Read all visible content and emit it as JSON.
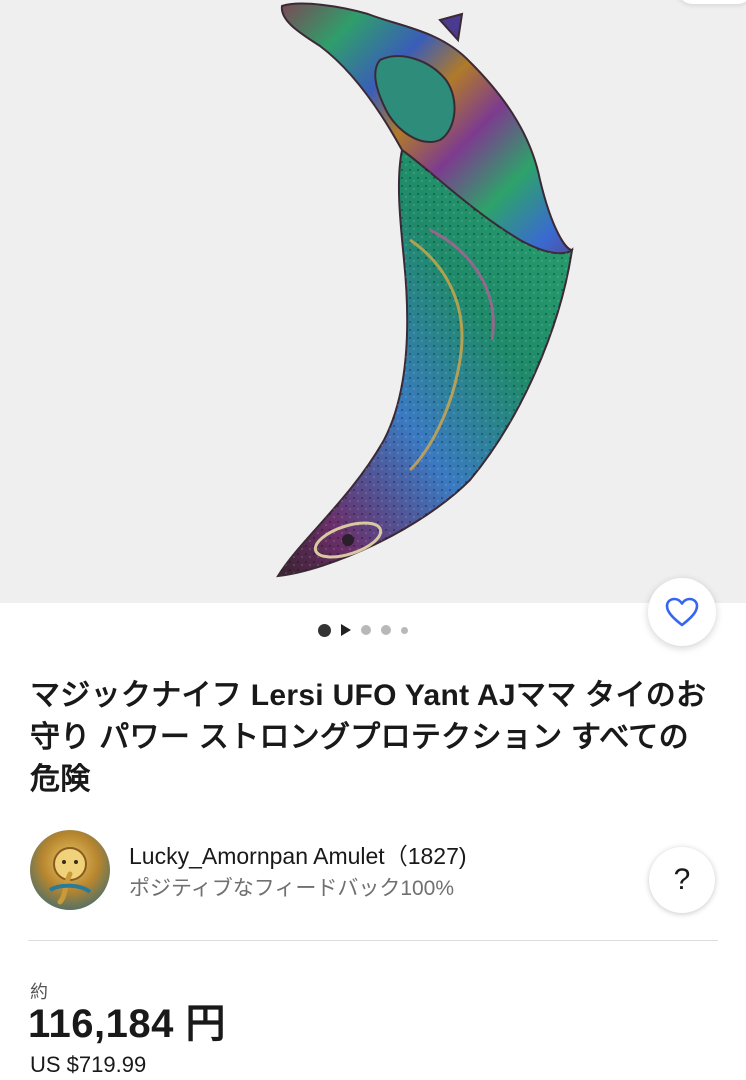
{
  "listing": {
    "title": "マジックナイフ Lersi UFO Yant AJママ タイのお守り パワー ストロングプロテクション すべての危険"
  },
  "gallery": {
    "image_description_icon": "amulet-knife-photo",
    "carousel_indicator": [
      "dot-active",
      "play-icon",
      "dot",
      "dot",
      "dot-small"
    ]
  },
  "seller": {
    "name": "Lucky_Amornpan Amulet（1827)",
    "feedback": "ポジティブなフィードバック100%",
    "help_label": "?"
  },
  "price": {
    "prefix": "約",
    "amount": "116,184 円",
    "usd": "US $719.99"
  },
  "colors": {
    "heart_accent": "#3665f3",
    "text_primary": "#191919",
    "text_secondary": "#707070",
    "image_background": "#efefef"
  }
}
